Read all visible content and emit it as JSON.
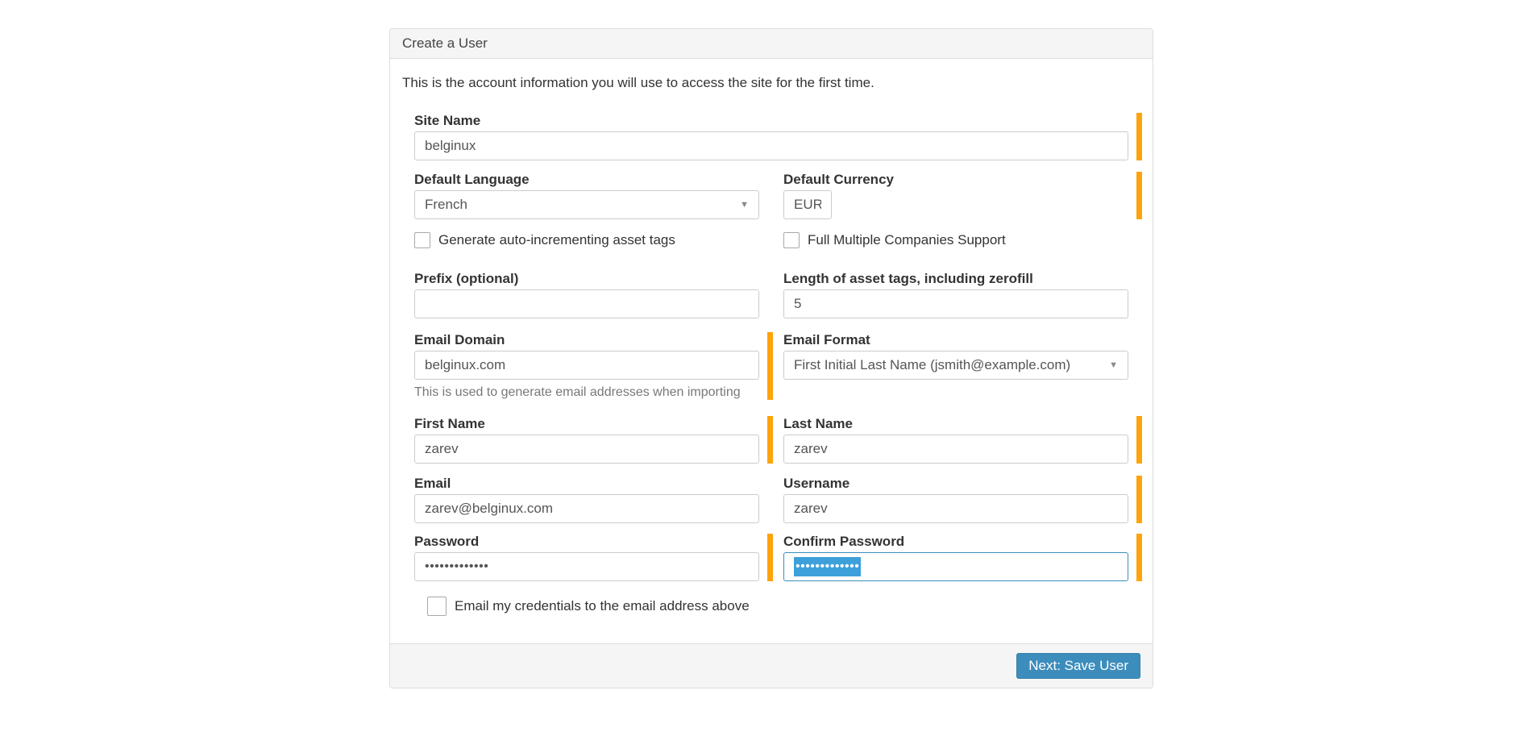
{
  "card": {
    "title": "Create a User",
    "intro": "This is the account information you will use to access the site for the first time."
  },
  "fields": {
    "site_name": {
      "label": "Site Name",
      "value": "belginux"
    },
    "default_language": {
      "label": "Default Language",
      "value": "French"
    },
    "default_currency": {
      "label": "Default Currency",
      "value": "EUR"
    },
    "auto_increment_tags": {
      "label": "Generate auto-incrementing asset tags",
      "checked": false
    },
    "multiple_companies": {
      "label": "Full Multiple Companies Support",
      "checked": false
    },
    "prefix": {
      "label": "Prefix (optional)",
      "value": "",
      "placeholder": ""
    },
    "zerofill": {
      "label": "Length of asset tags, including zerofill",
      "value": "5"
    },
    "email_domain": {
      "label": "Email Domain",
      "value": "belginux.com",
      "help": "This is used to generate email addresses when importing"
    },
    "email_format": {
      "label": "Email Format",
      "value": "First Initial Last Name (jsmith@example.com)"
    },
    "first_name": {
      "label": "First Name",
      "value": "zarev"
    },
    "last_name": {
      "label": "Last Name",
      "value": "zarev"
    },
    "email": {
      "label": "Email",
      "value": "zarev@belginux.com"
    },
    "username": {
      "label": "Username",
      "value": "zarev"
    },
    "password": {
      "label": "Password",
      "value": "•••••••••••••"
    },
    "confirm_password": {
      "label": "Confirm Password",
      "value": "•••••••••••••"
    },
    "email_credentials": {
      "label": "Email my credentials to the email address above",
      "checked": false
    }
  },
  "icons": {
    "dropdown_arrow": "▼"
  },
  "footer": {
    "next_button_label": "Next: Save User"
  },
  "colors": {
    "required_bar_orange": "#FFA30B",
    "primary_button_blue": "#3C8DBC",
    "focus_border_blue": "#3C8DBC",
    "selection_highlight_blue": "#3DA0DA",
    "header_footer_gray": "#F5F5F5",
    "input_border_gray": "#CCCCCC"
  }
}
